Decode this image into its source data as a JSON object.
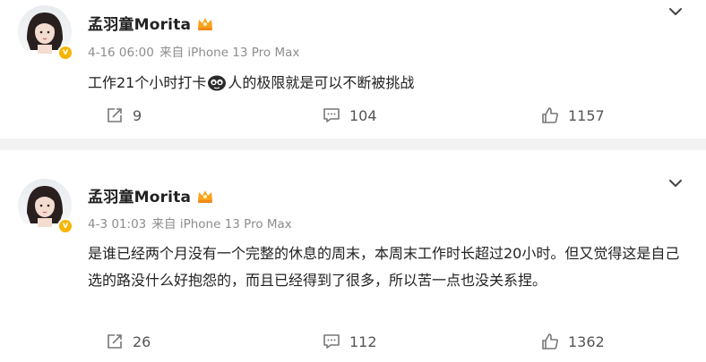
{
  "posts": [
    {
      "author": "孟羽童Morita",
      "date": "4-16 06:00",
      "source": "来自 iPhone 13 Pro Max",
      "text_before_emoji": "工作21个小时打卡",
      "text_after_emoji": "人的极限就是可以不断被挑战",
      "forwards": "9",
      "comments": "104",
      "likes": "1157"
    },
    {
      "author": "孟羽童Morita",
      "date": "4-3 01:03",
      "source": "来自 iPhone 13 Pro Max",
      "text": "是谁已经两个月没有一个完整的休息的周末，本周末工作时长超过20小时。但又觉得这是自己选的路没什么好抱怨的，而且已经得到了很多，所以苦一点也没关系捏。",
      "forwards": "26",
      "comments": "112",
      "likes": "1362"
    }
  ],
  "icons": {
    "verified": "verified-badge-icon",
    "crown": "vip-crown-icon",
    "more": "chevron-down-icon",
    "forward": "forward-icon",
    "comment": "comment-icon",
    "like": "like-icon",
    "emoji": "emoji-icon"
  },
  "colors": {
    "background": "#f2f2f2",
    "card": "#ffffff",
    "meta": "#8d8d8d",
    "badge": "#f7b500"
  }
}
